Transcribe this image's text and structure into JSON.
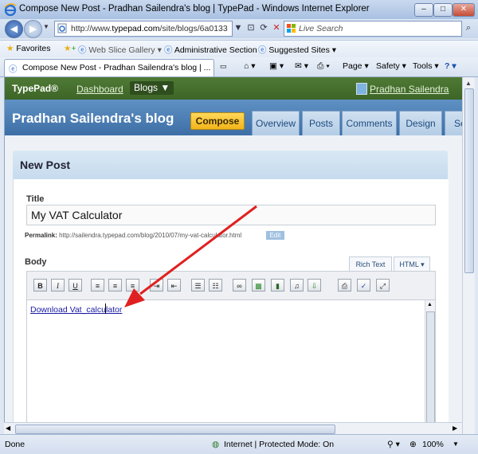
{
  "window": {
    "title": "Compose New Post - Pradhan Sailendra's blog | TypePad - Windows Internet Explorer",
    "buttons": {
      "minimize": "–",
      "maximize": "□",
      "close": "✕"
    }
  },
  "addressbar": {
    "url_prefix": "http://www.",
    "url_domain": "typepad.com",
    "url_rest": "/site/blogs/6a0133",
    "search_placeholder": "Live Search"
  },
  "favorites": {
    "favorites_label": "Favorites",
    "items": [
      "Web Slice Gallery ▾",
      "Administrative Section",
      "Suggested Sites ▾"
    ]
  },
  "tab": {
    "label": "Compose New Post - Pradhan Sailendra's blog | ..."
  },
  "commandbar": {
    "page": "Page ▾",
    "safety": "Safety ▾",
    "tools": "Tools ▾",
    "help": "? ▾"
  },
  "typepad": {
    "logo": "TypePad®",
    "dashboard": "Dashboard",
    "blogs": "Blogs ▼",
    "user": "Pradhan Sailendra",
    "blog_title": "Pradhan Sailendra's blog",
    "compose": "Compose",
    "tabs": [
      "Overview",
      "Posts",
      "Comments",
      "Design",
      "Set"
    ]
  },
  "post": {
    "heading": "New Post",
    "title_label": "Title",
    "title_value": "My VAT Calculator",
    "permalink_label": "Permalink:",
    "permalink_url": "http://sailendra.typepad.com/blog/2010/07/my-vat-calculator.html",
    "edit_label": "Edit",
    "body_label": "Body",
    "rich_text": "Rich Text",
    "html_tab": "HTML ▾",
    "toolbar": [
      "B",
      "I",
      "U"
    ],
    "body_link": "Download Vat_calculator"
  },
  "statusbar": {
    "left": "Done",
    "zone": "Internet | Protected Mode: On",
    "zoom": "100%"
  },
  "colors": {
    "arrow": "#e02020",
    "typepad_green": "#4f7a35",
    "blog_blue": "#3d6fa6",
    "compose_yellow": "#f2b419"
  }
}
